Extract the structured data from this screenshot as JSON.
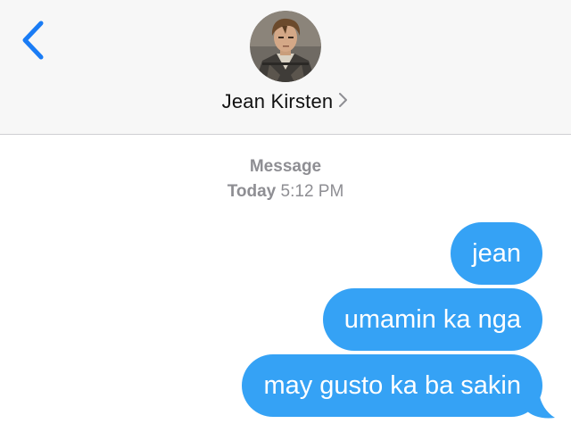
{
  "header": {
    "contact_name": "Jean Kirsten",
    "back_icon": "chevron-left-icon",
    "disclosure_icon": "chevron-right-icon",
    "accent_color": "#1a7cf5"
  },
  "thread": {
    "service": "Message",
    "day": "Today",
    "time": "5:12 PM"
  },
  "messages": [
    {
      "text": "jean",
      "direction": "outgoing"
    },
    {
      "text": "umamin ka nga",
      "direction": "outgoing"
    },
    {
      "text": "may gusto ka ba sakin",
      "direction": "outgoing"
    }
  ],
  "colors": {
    "bubble": "#35a2f5",
    "bubble_text": "#ffffff",
    "meta_text": "#8e8e93",
    "header_bg": "#f7f7f7"
  }
}
